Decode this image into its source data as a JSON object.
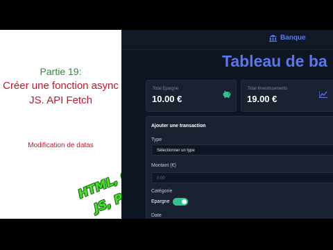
{
  "slide": {
    "part": "Partie 19:",
    "subtitle_line1": "Créer une fonction async",
    "subtitle_line2": "JS. API Fetch",
    "note": "Modification de datas",
    "tech_line1": "HTML, CSS",
    "tech_line2": "JS, PHP"
  },
  "app": {
    "brand": "Banque",
    "page_title": "Tableau de ba",
    "cards": [
      {
        "label": "Total Epargne",
        "value": "10.00 €",
        "icon": "piggy-bank-icon"
      },
      {
        "label": "Total Investissements",
        "value": "19.00 €",
        "icon": "chart-line-icon"
      }
    ],
    "form": {
      "title": "Ajouter une transaction",
      "type_label": "Type",
      "type_select_value": "Sélectionner un type",
      "amount_label": "Montant (€)",
      "amount_placeholder": "0.00",
      "category_label": "Catégorie",
      "category_value": "Epargne",
      "date_label": "Date"
    }
  },
  "colors": {
    "accent": "#5a78ee",
    "toggle": "#2fc48f",
    "bg_dark": "#0f1623",
    "slide_green": "#2e8b2e",
    "slide_red": "#c0182a",
    "tech_green": "#46e02a"
  }
}
